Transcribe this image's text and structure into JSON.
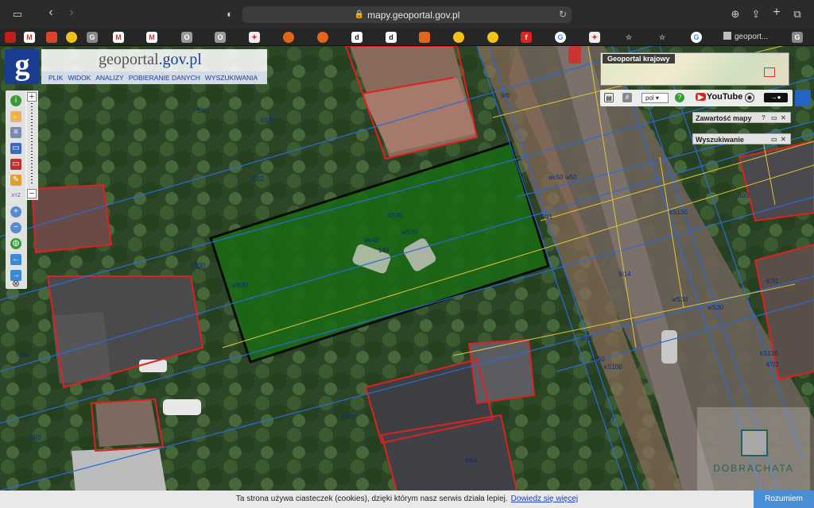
{
  "browser": {
    "url": "mapy.geoportal.gov.pl",
    "active_tab": "geoport...",
    "favicons": [
      "red",
      "gmail",
      "red",
      "yellow",
      "grey",
      "gmail",
      "gmail",
      "grey",
      "grey",
      "shield",
      "orange",
      "orange",
      "d",
      "d",
      "orange",
      "yellow",
      "yellow",
      "red",
      "google",
      "shield",
      "star",
      "star",
      "google"
    ]
  },
  "header": {
    "logo_letter": "g",
    "brand_prefix": "geoportal",
    "brand_suffix": ".gov.pl",
    "menu": [
      "PLIK",
      "WIDOK",
      "ANALIZY",
      "POBIERANIE DANYCH",
      "WYSZUKIWANIA"
    ]
  },
  "right_panel": {
    "overview_title": "Geoportal krajowy",
    "language": "pol",
    "youtube_label": "YouTube",
    "map_contents": "Zawartość mapy",
    "search": "Wyszukiwanie"
  },
  "map_labels": {
    "parcels": [
      "52/1",
      "52/2",
      "58/1",
      "64/2",
      "66/3",
      "66/4",
      "9/6",
      "9/11",
      "9/14",
      "9/16",
      "9/7",
      "80/2",
      "67/1",
      "67/2",
      "73",
      "149"
    ],
    "lines": [
      "kS30",
      "kS30",
      "wc50",
      "wc40",
      "wS30",
      "wS30",
      "kS30",
      "wo40",
      "wc50 w50",
      "wS30",
      "wS30",
      "wS0",
      "kS100",
      "wS0",
      "kS130",
      "kS130",
      "wS0"
    ]
  },
  "cookie": {
    "text": "Ta strona używa ciasteczek (cookies), dzięki którym nasz serwis działa lepiej.",
    "link": "Dowiedz się więcej",
    "button": "Rozumiem"
  },
  "watermark": "DOBRACHATA"
}
